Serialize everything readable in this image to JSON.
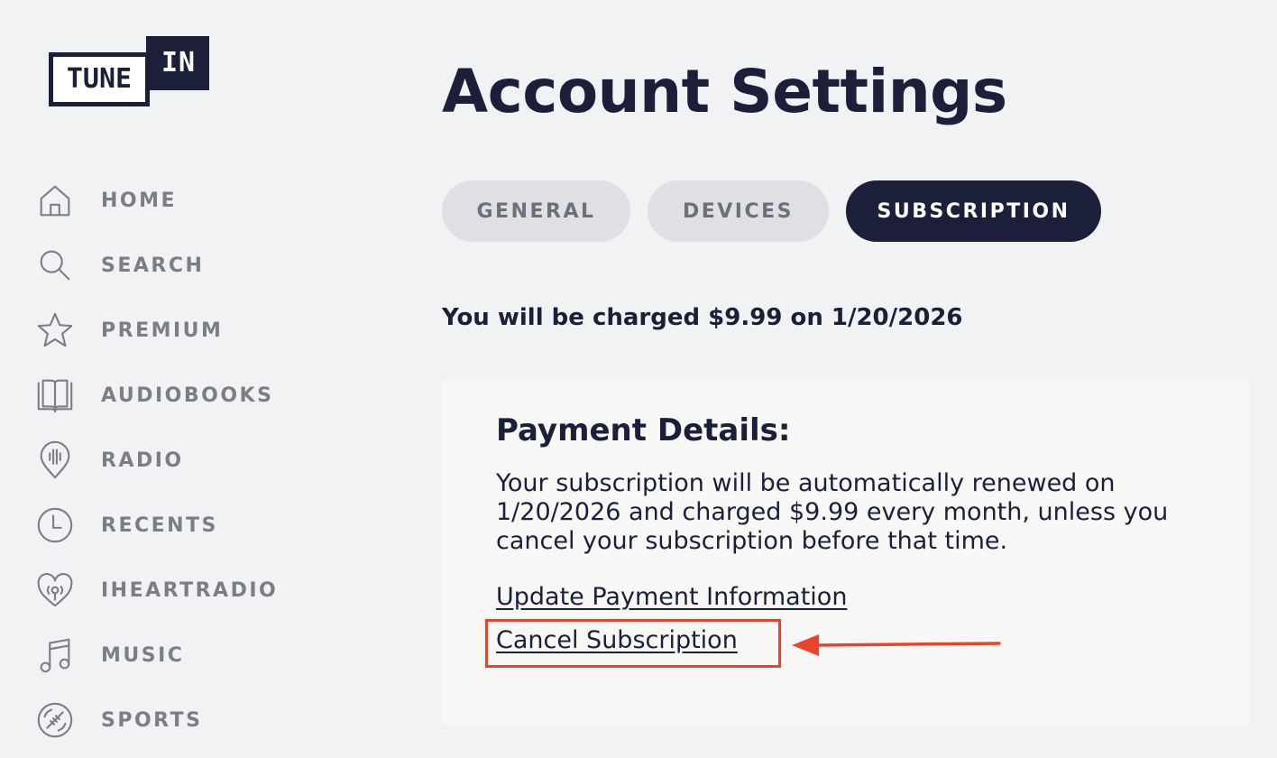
{
  "logo": {
    "tune": "TUNE",
    "in": "IN"
  },
  "sidebar": {
    "items": [
      {
        "label": "HOME",
        "icon": "home-icon"
      },
      {
        "label": "SEARCH",
        "icon": "search-icon"
      },
      {
        "label": "PREMIUM",
        "icon": "star-icon"
      },
      {
        "label": "AUDIOBOOKS",
        "icon": "book-icon"
      },
      {
        "label": "RADIO",
        "icon": "radio-pin-icon"
      },
      {
        "label": "RECENTS",
        "icon": "clock-icon"
      },
      {
        "label": "IHEARTRADIO",
        "icon": "heart-radio-icon"
      },
      {
        "label": "MUSIC",
        "icon": "music-note-icon"
      },
      {
        "label": "SPORTS",
        "icon": "football-icon"
      }
    ]
  },
  "main": {
    "title": "Account Settings",
    "tabs": [
      {
        "label": "GENERAL",
        "active": false
      },
      {
        "label": "DEVICES",
        "active": false
      },
      {
        "label": "SUBSCRIPTION",
        "active": true
      }
    ],
    "charge_notice": "You will be charged $9.99 on 1/20/2026",
    "payment": {
      "heading": "Payment Details:",
      "description": "Your subscription will be automatically renewed on 1/20/2026 and charged $9.99 every month, unless you cancel your subscription before that time.",
      "update_link": "Update Payment Information",
      "cancel_link": "Cancel Subscription"
    }
  },
  "colors": {
    "background": "#f1f2f4",
    "navy": "#1c1f3a",
    "muted": "#7c7e86",
    "tab_inactive": "#dfe0e4",
    "card": "#f7f7f6",
    "annotation_red": "#e8442b"
  }
}
